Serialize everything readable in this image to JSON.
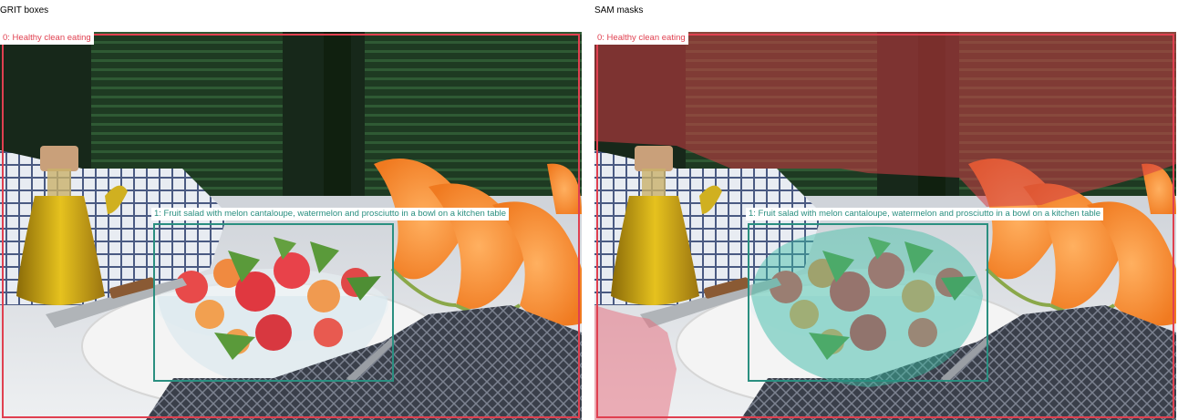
{
  "panels": {
    "left": {
      "title": "GRIT boxes"
    },
    "right": {
      "title": "SAM masks"
    }
  },
  "annotations": {
    "box0_label": "0: Healthy clean eating",
    "box1_label": "1: Fruit salad with melon cantaloupe, watermelon and prosciutto in a bowl on a kitchen table"
  },
  "colors": {
    "box0": "#e04050",
    "box1": "#2a8f80",
    "mask0": "#d23c46",
    "mask1": "#3cbfa5"
  }
}
